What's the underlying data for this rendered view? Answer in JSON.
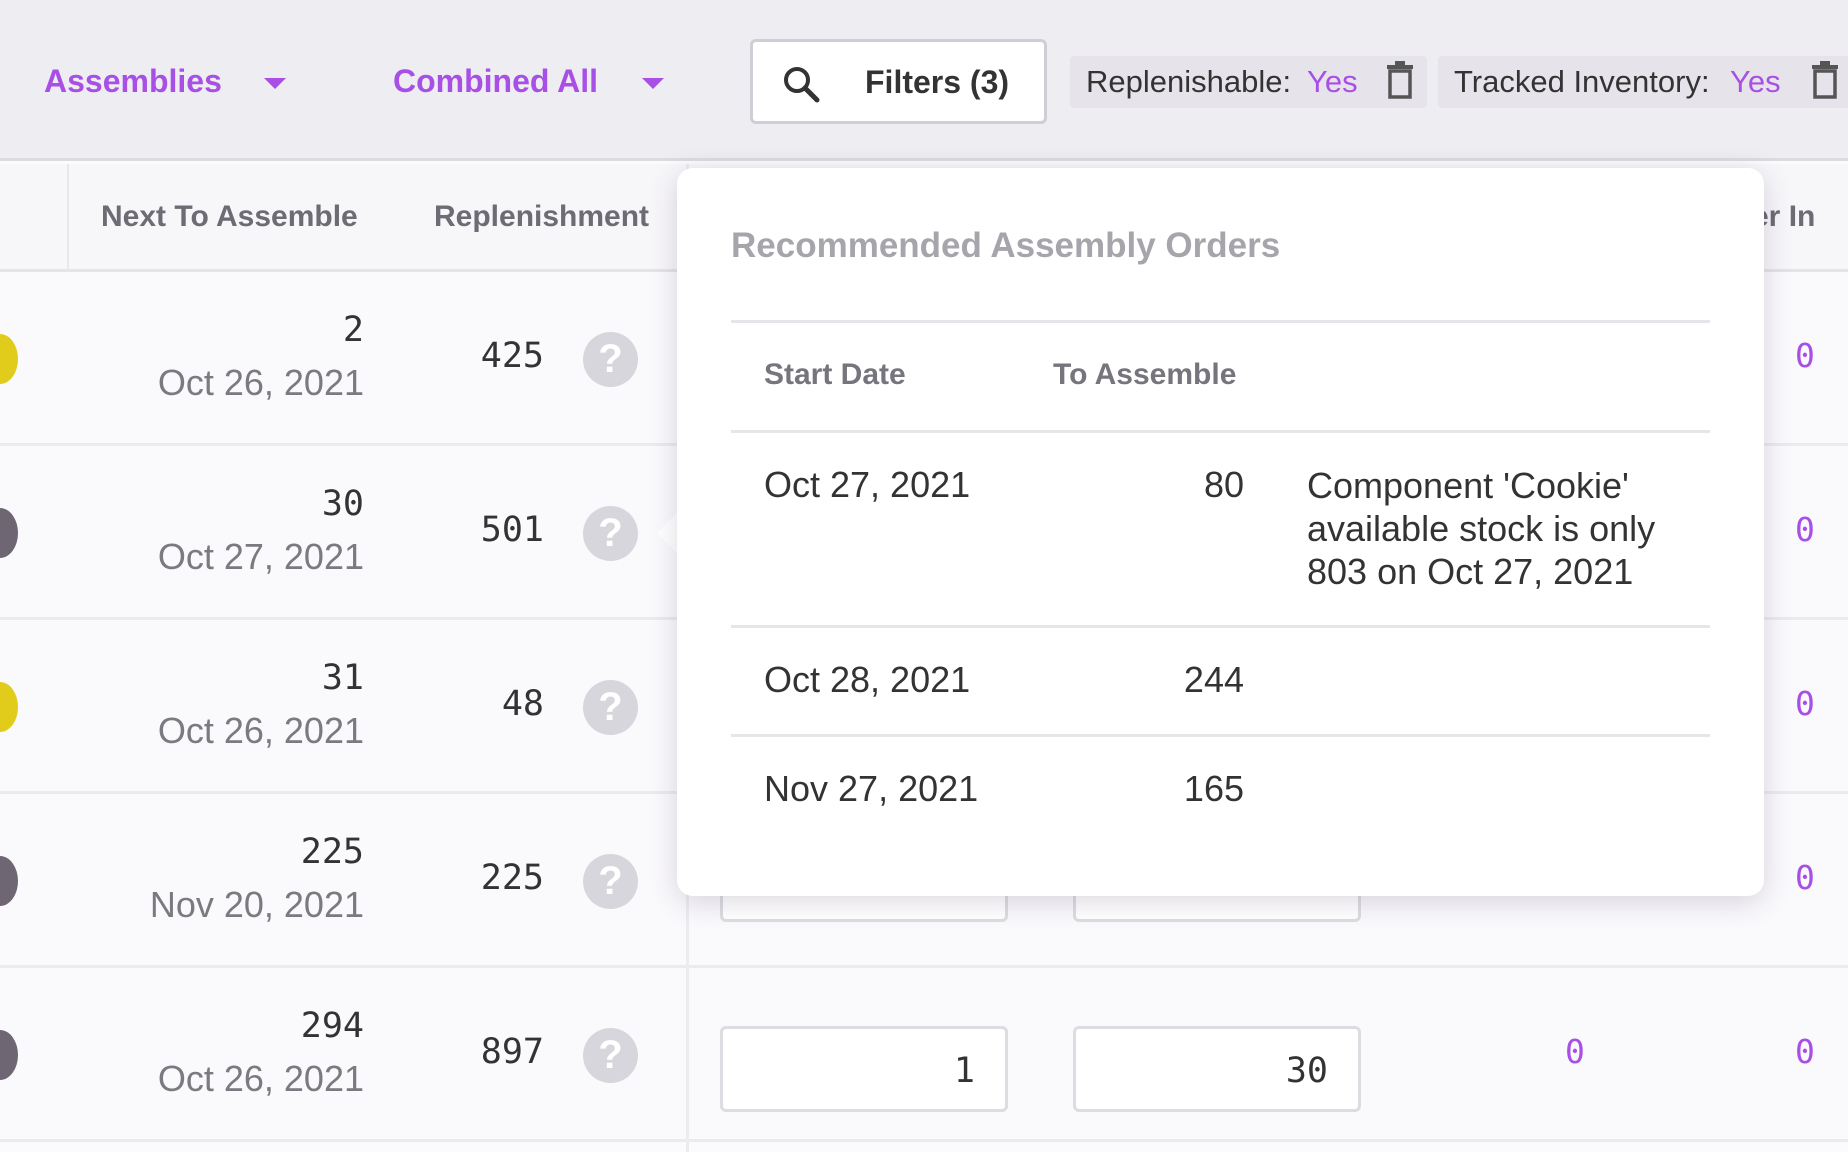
{
  "toolbar": {
    "type_dropdown": "Assemblies",
    "location_dropdown": "Combined All",
    "filters_button": "Filters (3)",
    "chips": [
      {
        "key": "Replenishable:",
        "value": "Yes"
      },
      {
        "key": "Tracked Inventory:",
        "value": "Yes"
      }
    ]
  },
  "table": {
    "headers": {
      "next_to_assemble": "Next To Assemble",
      "replenishment": "Replenishment",
      "truncated_right": "er In"
    },
    "rows": [
      {
        "status_color": "#e2cc1b",
        "qty": "2",
        "date": "Oct 26, 2021",
        "replenishment": "425",
        "col_right": "0"
      },
      {
        "status_color": "#6e6673",
        "qty": "30",
        "date": "Oct 27, 2021",
        "replenishment": "501",
        "col_right": "0"
      },
      {
        "status_color": "#e2cc1b",
        "qty": "31",
        "date": "Oct 26, 2021",
        "replenishment": "48",
        "col_right": "0"
      },
      {
        "status_color": "#6e6673",
        "qty": "225",
        "date": "Nov 20, 2021",
        "replenishment": "225",
        "col_right": "0"
      },
      {
        "status_color": "#6e6673",
        "qty": "294",
        "date": "Oct 26, 2021",
        "replenishment": "897",
        "input_a": "1",
        "input_b": "30",
        "col_mid": "0",
        "col_right": "0"
      }
    ]
  },
  "popover": {
    "title": "Recommended Assembly Orders",
    "headers": {
      "start_date": "Start Date",
      "to_assemble": "To Assemble"
    },
    "rows": [
      {
        "start_date": "Oct 27, 2021",
        "to_assemble": "80",
        "note": "Component 'Cookie' available stock is only 803 on Oct 27, 2021"
      },
      {
        "start_date": "Oct 28, 2021",
        "to_assemble": "244",
        "note": ""
      },
      {
        "start_date": "Nov 27, 2021",
        "to_assemble": "165",
        "note": ""
      }
    ]
  },
  "icons": {
    "help": "question-mark-icon",
    "search": "search-icon",
    "trash": "trash-icon",
    "caret": "chevron-down-icon"
  },
  "colors": {
    "accent": "#a84fe6",
    "status_yellow": "#e2cc1b",
    "status_gray": "#6e6673"
  }
}
